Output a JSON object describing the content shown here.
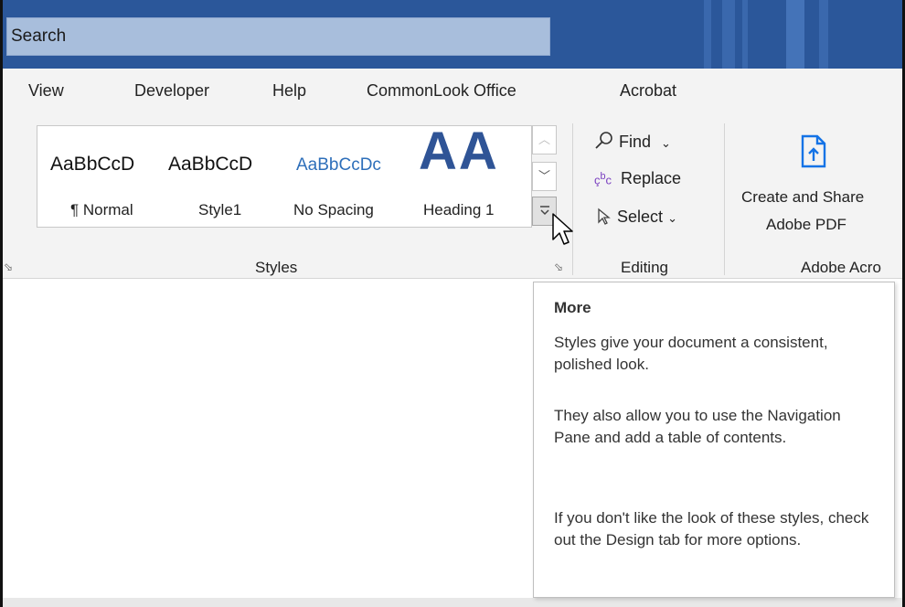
{
  "search": {
    "label": "Search"
  },
  "tabs": [
    "View",
    "Developer",
    "Help",
    "CommonLook Office",
    "Acrobat"
  ],
  "styles": {
    "items": [
      {
        "preview": "AaBbCcD",
        "name": "¶ Normal"
      },
      {
        "preview": "AaBbCcD",
        "name": "Style1"
      },
      {
        "preview": "AaBbCcDc",
        "name": "No Spacing"
      },
      {
        "preview": "AA",
        "name": "Heading 1"
      }
    ],
    "group_label": "Styles"
  },
  "editing": {
    "find": "Find",
    "replace": "Replace",
    "select": "Select",
    "group_label": "Editing"
  },
  "adobe": {
    "line1": "Create and Share",
    "line2": "Adobe PDF",
    "group_label": "Adobe Acro"
  },
  "tooltip": {
    "title": "More",
    "p1": "Styles give your document a consistent, polished look.",
    "p2": "They also allow you to use the Navigation Pane and add a table of contents.",
    "p3": "If you don't like the look of these styles, check out the Design tab for more options."
  },
  "colors": {
    "titlebar": "#2b579a",
    "search_box": "#a8bedc",
    "heading_blue": "#2f5496",
    "nospacing_blue": "#2e6fba",
    "replace_icon": "#7a3fc0",
    "adobe_icon": "#1473e6"
  },
  "icons": [
    "search-find-icon",
    "replace-icon",
    "select-arrow-icon",
    "create-pdf-icon",
    "cursor-icon",
    "dialog-launcher-icon"
  ]
}
